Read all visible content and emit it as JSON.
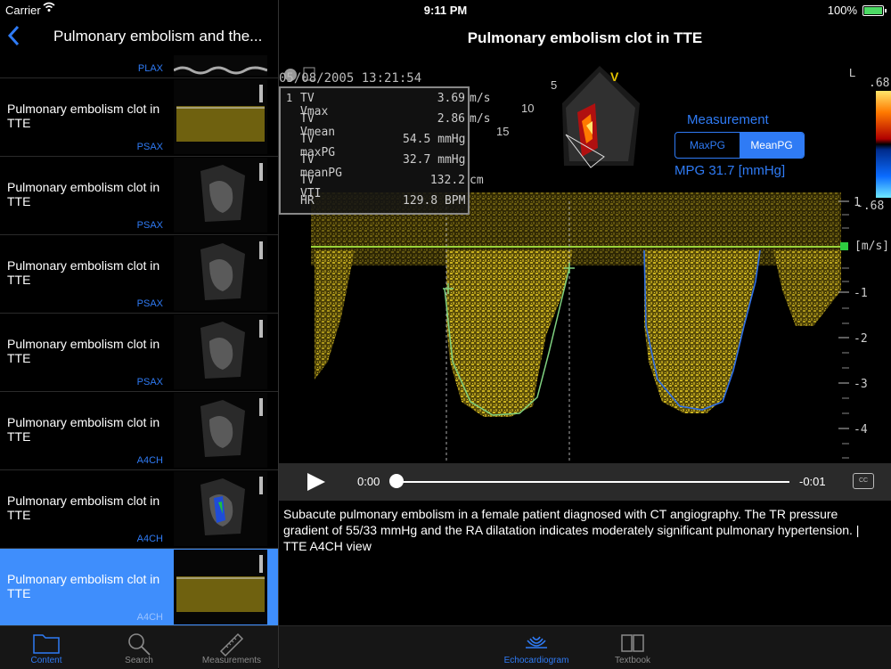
{
  "status": {
    "carrier": "Carrier",
    "time": "9:11 PM",
    "battery": "100%"
  },
  "left": {
    "title": "Pulmonary embolism and the...",
    "top_partial_view": "PLAX",
    "items": [
      {
        "label": "Pulmonary embolism clot in TTE",
        "view": "PSAX"
      },
      {
        "label": "Pulmonary embolism clot in TTE",
        "view": "PSAX"
      },
      {
        "label": "Pulmonary embolism clot in TTE",
        "view": "PSAX"
      },
      {
        "label": "Pulmonary embolism clot in TTE",
        "view": "PSAX"
      },
      {
        "label": "Pulmonary embolism clot in TTE",
        "view": "A4CH"
      },
      {
        "label": "Pulmonary embolism clot in TTE",
        "view": "A4CH"
      },
      {
        "label": "Pulmonary embolism clot in TTE",
        "view": "A4CH"
      }
    ],
    "tabs": [
      "Content",
      "Search",
      "Measurements"
    ]
  },
  "right": {
    "title": "Pulmonary embolism clot in TTE",
    "timestamp": "05/08/2005 13:21:54",
    "measurements": [
      {
        "k": "TV Vmax",
        "v": "3.69",
        "u": "m/s"
      },
      {
        "k": "TV Vmean",
        "v": "2.86",
        "u": "m/s"
      },
      {
        "k": "TV maxPG",
        "v": "54.5 mmHg",
        "u": ""
      },
      {
        "k": "TV meanPG",
        "v": "32.7 mmHg",
        "u": ""
      },
      {
        "k": "TV VTI",
        "v": "132.2",
        "u": "cm"
      },
      {
        "k": "HR",
        "v": "129.8 BPM",
        "u": ""
      }
    ],
    "measure_index": "1",
    "measurement_label": "Measurement",
    "seg_maxpg": "MaxPG",
    "seg_meanpg": "MeanPG",
    "mpg": "MPG 31.7 [mmHg]",
    "scale": {
      "unit": "[m/s]",
      "ticks": [
        "1",
        "-1",
        "-2",
        "-3",
        "-4"
      ],
      "colorbar_top": ".68",
      "colorbar_bottom": "-.68",
      "L": "L",
      "depth": [
        "5",
        "10",
        "15"
      ],
      "V": "V"
    },
    "player": {
      "start": "0:00",
      "end": "-0:01",
      "cc": "CC"
    },
    "caption": "Subacute pulmonary embolism in a female patient diagnosed with CT angiography. The TR pressure gradient of 55/33 mmHg and the RA dilatation indicates moderately significant pulmonary hypertension. | TTE A4CH view",
    "tabs": [
      "Echocardiogram",
      "Textbook"
    ]
  },
  "colors": {
    "accent": "#2f7bf5",
    "selected_row": "#3f8efc",
    "doppler": "#c9b11f",
    "trace_green": "#7fd07f",
    "trace_blue": "#2e6ee6"
  }
}
